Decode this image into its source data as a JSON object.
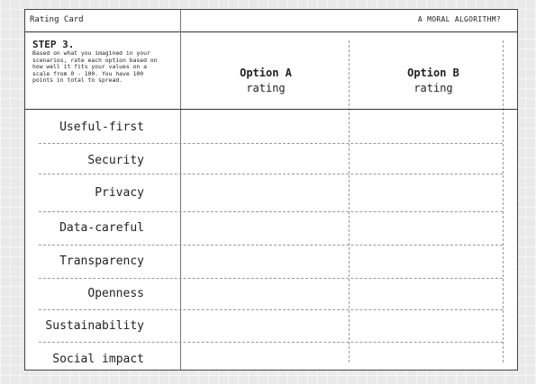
{
  "card": {
    "title": "Rating Card",
    "header_right": "A MORAL ALGORITHM?"
  },
  "step": {
    "title": "STEP 3.",
    "instructions": "Based on what you imagined in your scenarios, rate each option based on how well it fits your values on a scale from 0 - 100. You have 100 points in total to spread."
  },
  "options": [
    {
      "name": "Option A",
      "sub": "rating"
    },
    {
      "name": "Option B",
      "sub": "rating"
    }
  ],
  "values": [
    "Useful-first",
    "Security",
    "Privacy",
    "Data-careful",
    "Transparency",
    "Openness",
    "Sustainability",
    "Social impact"
  ]
}
